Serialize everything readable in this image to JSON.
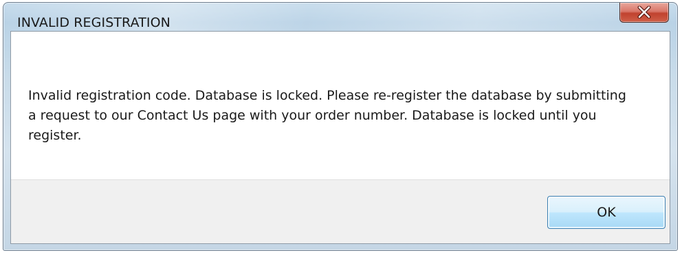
{
  "dialog": {
    "title": "INVALID REGISTRATION",
    "message": "Invalid registration code.  Database is locked.  Please re-register the database by submitting a request to our Contact Us page with your order number.  Database is locked until you register.",
    "ok_label": "OK",
    "close_icon": "close-icon"
  },
  "colors": {
    "close_button": "#c7493a",
    "ok_button_border": "#3c7fb1",
    "button_area_bg": "#f0f0f0"
  }
}
